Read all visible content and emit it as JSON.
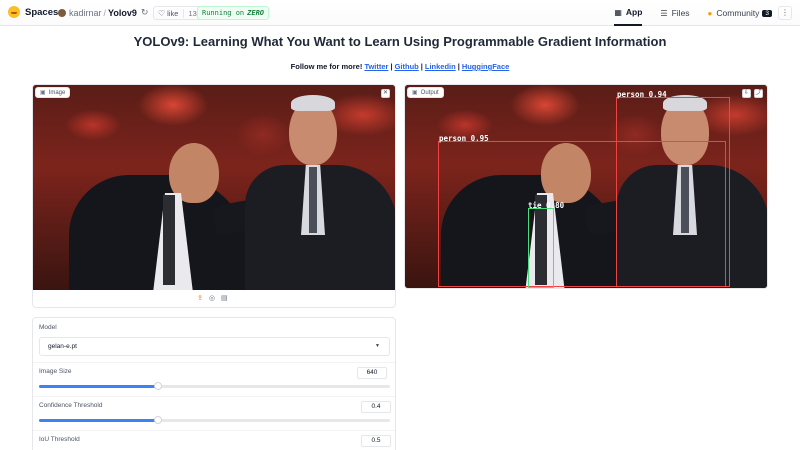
{
  "header": {
    "brand": "Spaces",
    "owner": "kadirnar",
    "repo": "Yolov9",
    "like_label": "like",
    "like_count": "13",
    "status_prefix": "Running on",
    "status_hw": "ZERO",
    "tabs": [
      {
        "label": "App",
        "icon": "app-icon",
        "active": true
      },
      {
        "label": "Files",
        "icon": "files-icon",
        "active": false
      },
      {
        "label": "Community",
        "icon": "community-icon",
        "badge": "3",
        "active": false
      }
    ],
    "menu_icon": "more-icon"
  },
  "page": {
    "title": "YOLOv9: Learning What You Want to Learn Using Programmable Gradient Information",
    "follow_text": "Follow me for more!",
    "links": [
      "Twitter",
      "Github",
      "Linkedin",
      "HuggingFace"
    ]
  },
  "input_panel": {
    "label": "Image",
    "icons": [
      "image-icon",
      "clear-icon",
      "upload-icon",
      "webcam-icon",
      "clipboard-icon"
    ]
  },
  "output_panel": {
    "label": "Output",
    "detections": [
      {
        "label": "person 0.94",
        "color": "#ef4444"
      },
      {
        "label": "person 0.95",
        "color": "#ef4444"
      },
      {
        "label": "tie 0.80",
        "color": "#4ade80"
      }
    ],
    "icons": [
      "download-icon",
      "share-icon"
    ]
  },
  "settings": {
    "model_label": "Model",
    "model_value": "gelan-e.pt",
    "image_size_label": "Image Size",
    "image_size_value": "640",
    "image_size_fraction": 0.34,
    "conf_label": "Confidence Threshold",
    "conf_value": "0.4",
    "conf_fraction": 0.34,
    "iou_label": "IoU Threshold",
    "iou_value": "0.5"
  },
  "colors": {
    "accent": "#3b82f6",
    "link": "#2563eb",
    "box": "#ef4444",
    "tie_box": "#4ade80"
  }
}
